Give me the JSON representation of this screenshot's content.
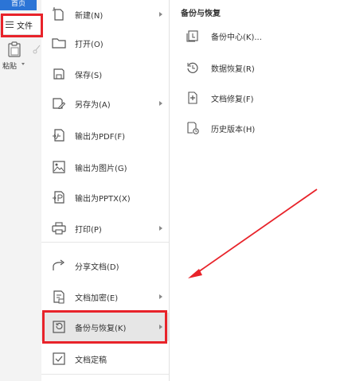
{
  "toolbar": {
    "home_tab": "首页",
    "file_button": "文件",
    "paste_label": "粘贴"
  },
  "main_menu": {
    "items": [
      {
        "label": "新建(N)",
        "icon": "new-file-icon",
        "has_submenu": true
      },
      {
        "label": "打开(O)",
        "icon": "folder-open-icon",
        "has_submenu": false
      },
      {
        "label": "保存(S)",
        "icon": "save-icon",
        "has_submenu": false
      },
      {
        "label": "另存为(A)",
        "icon": "save-as-icon",
        "has_submenu": true
      },
      {
        "label": "输出为PDF(F)",
        "icon": "export-pdf-icon",
        "has_submenu": false
      },
      {
        "label": "输出为图片(G)",
        "icon": "export-image-icon",
        "has_submenu": false
      },
      {
        "label": "输出为PPTX(X)",
        "icon": "export-pptx-icon",
        "has_submenu": false
      },
      {
        "label": "打印(P)",
        "icon": "printer-icon",
        "has_submenu": true
      },
      {
        "label": "分享文档(D)",
        "icon": "share-icon",
        "has_submenu": false
      },
      {
        "label": "文档加密(E)",
        "icon": "encrypt-icon",
        "has_submenu": true
      },
      {
        "label": "备份与恢复(K)",
        "icon": "backup-restore-icon",
        "has_submenu": true,
        "selected": true
      },
      {
        "label": "文档定稿",
        "icon": "finalize-icon",
        "has_submenu": false
      }
    ]
  },
  "sub_menu": {
    "title": "备份与恢复",
    "items": [
      {
        "label": "备份中心(K)...",
        "icon": "backup-center-icon"
      },
      {
        "label": "数据恢复(R)",
        "icon": "data-recovery-icon"
      },
      {
        "label": "文档修复(F)",
        "icon": "document-repair-icon"
      },
      {
        "label": "历史版本(H)",
        "icon": "history-version-icon"
      }
    ]
  },
  "colors": {
    "highlight_box": "#e8232a",
    "annotation_arrow": "#e8232a",
    "home_tab_bg": "#2b74d6",
    "selected_item_bg": "#e6e6e6"
  }
}
